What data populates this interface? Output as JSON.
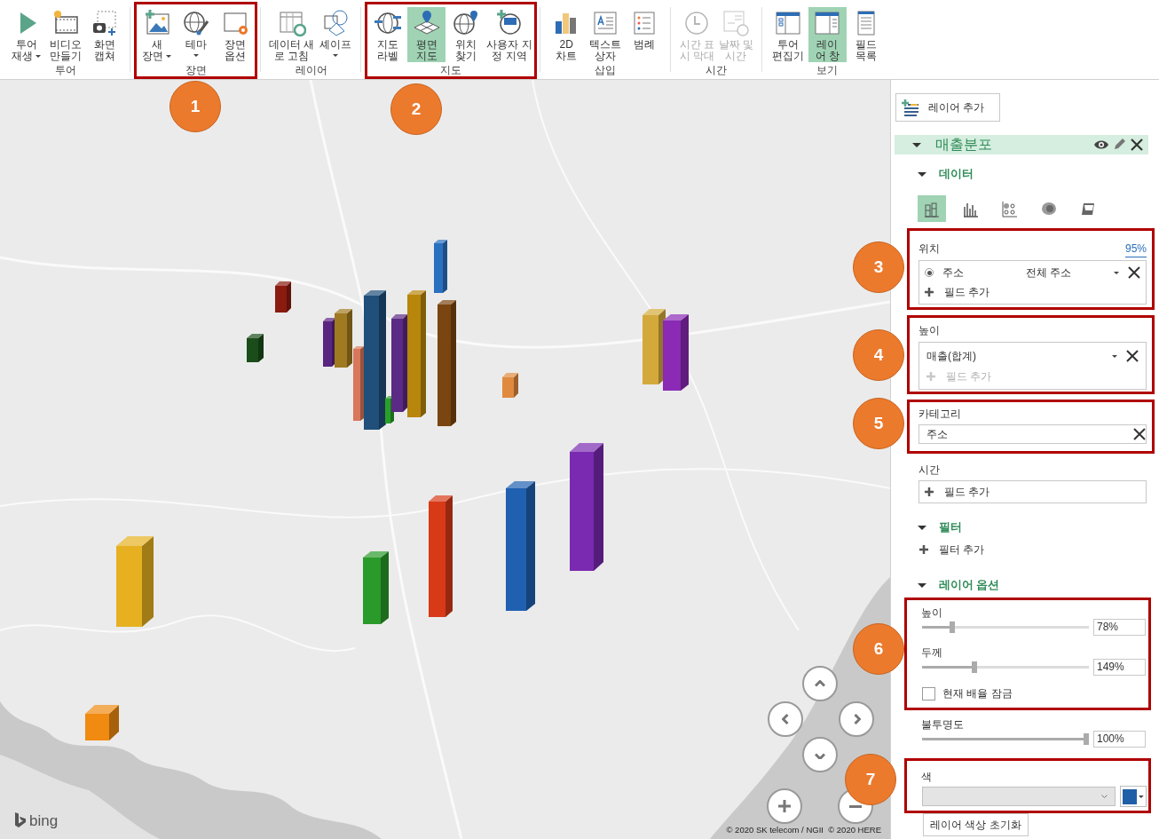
{
  "ribbon": {
    "groups": [
      {
        "label": "투어",
        "buttons": [
          {
            "label": "투어\n재생",
            "dropdown": true,
            "selected": false,
            "disabled": false
          },
          {
            "label": "비디오\n만들기",
            "selected": false,
            "disabled": false
          },
          {
            "label": "화면\n캡쳐",
            "selected": false,
            "disabled": false
          }
        ]
      },
      {
        "label": "장면",
        "highlighted": true,
        "buttons": [
          {
            "label": "새\n장면",
            "dropdown": true,
            "selected": false,
            "disabled": false
          },
          {
            "label": "테마",
            "dropdown": true,
            "selected": false,
            "disabled": false
          },
          {
            "label": "장면\n옵션",
            "selected": false,
            "disabled": false
          }
        ]
      },
      {
        "label": "레이어",
        "buttons": [
          {
            "label": "데이터 새\n로 고침",
            "selected": false,
            "disabled": false
          },
          {
            "label": "셰이프",
            "dropdown": true,
            "selected": false,
            "disabled": false
          }
        ]
      },
      {
        "label": "지도",
        "highlighted": true,
        "buttons": [
          {
            "label": "지도\n라벨",
            "selected": false,
            "disabled": false
          },
          {
            "label": "평면\n지도",
            "selected": true,
            "disabled": false
          },
          {
            "label": "위치\n찾기",
            "selected": false,
            "disabled": false
          },
          {
            "label": "사용자 지\n정 지역",
            "selected": false,
            "disabled": false
          }
        ]
      },
      {
        "label": "삽입",
        "buttons": [
          {
            "label": "2D\n차트",
            "selected": false,
            "disabled": false
          },
          {
            "label": "텍스트\n상자",
            "selected": false,
            "disabled": false
          },
          {
            "label": "범례",
            "selected": false,
            "disabled": false
          }
        ]
      },
      {
        "label": "시간",
        "buttons": [
          {
            "label": "시간 표\n시 막대",
            "selected": false,
            "disabled": true
          },
          {
            "label": "날짜 및\n시간",
            "selected": false,
            "disabled": true
          }
        ]
      },
      {
        "label": "보기",
        "buttons": [
          {
            "label": "투어\n편집기",
            "selected": false,
            "disabled": false
          },
          {
            "label": "레이\n어 창",
            "selected": true,
            "disabled": false
          },
          {
            "label": "필드\n목록",
            "selected": false,
            "disabled": false
          }
        ]
      }
    ]
  },
  "map": {
    "columns": [
      {
        "color": "#2a70c0"
      },
      {
        "color": "#8b1a10"
      },
      {
        "color": "#1a4d1a"
      },
      {
        "color": "#5a2580"
      },
      {
        "color": "#a07a20"
      },
      {
        "color": "#d9775a"
      },
      {
        "color": "#1f4f7a"
      },
      {
        "color": "#28a028"
      },
      {
        "color": "#5b2a85"
      },
      {
        "color": "#b8860b"
      },
      {
        "color": "#7a4510"
      },
      {
        "color": "#e08a40"
      },
      {
        "color": "#d4a93c"
      },
      {
        "color": "#8a2ab5"
      },
      {
        "color": "#e6b020"
      },
      {
        "color": "#f08a10"
      },
      {
        "color": "#2a9a2a"
      },
      {
        "color": "#d83a18"
      },
      {
        "color": "#2060b0"
      },
      {
        "color": "#7a2ab0"
      }
    ],
    "bing_logo": "bing",
    "attribution": "© 2020 SK telecom / NGII  © 2020 HERE"
  },
  "callouts": [
    {
      "number": "1"
    },
    {
      "number": "2"
    },
    {
      "number": "3"
    },
    {
      "number": "4"
    },
    {
      "number": "5"
    },
    {
      "number": "6"
    },
    {
      "number": "7"
    }
  ],
  "panel": {
    "add_layer_button": "레이어 추가",
    "layer": {
      "name": "매출분포",
      "expanded": true
    },
    "data_section": {
      "title": "데이터",
      "expanded": true,
      "viz_types": [
        {
          "selected": true
        },
        {
          "selected": false
        },
        {
          "selected": false
        },
        {
          "selected": false
        },
        {
          "selected": false
        }
      ],
      "location": {
        "label": "위치",
        "highlighted": true,
        "confidence": "95%",
        "fields": [
          {
            "name": "주소",
            "detail": "전체 주소",
            "radio_selected": true
          }
        ],
        "add_field": "필드 추가"
      },
      "height": {
        "label": "높이",
        "highlighted": true,
        "fields": [
          {
            "name": "매출(합계)"
          }
        ],
        "add_field": "필드 추가",
        "add_disabled": true
      },
      "category": {
        "label": "카테고리",
        "highlighted": true,
        "value": "주소"
      },
      "time": {
        "label": "시간",
        "add_field": "필드 추가"
      }
    },
    "filter_section": {
      "title": "필터",
      "expanded": true,
      "add_filter": "필터 추가"
    },
    "options_section": {
      "title": "레이어 옵션",
      "expanded": true,
      "sliders_highlighted": true,
      "sliders": [
        {
          "label": "높이",
          "level": 0.17,
          "value": "78%"
        },
        {
          "label": "두께",
          "level": 0.31,
          "value": "149%"
        }
      ],
      "lock_scale": {
        "label": "현재 배율 잠금",
        "checked": false
      },
      "opacity": {
        "label": "불투명도",
        "level": 1,
        "value": "100%"
      },
      "color_picker": {
        "label": "색",
        "highlighted": true,
        "color": "#1f5fa8"
      },
      "reset_button": "레이어 색상 초기화"
    }
  }
}
